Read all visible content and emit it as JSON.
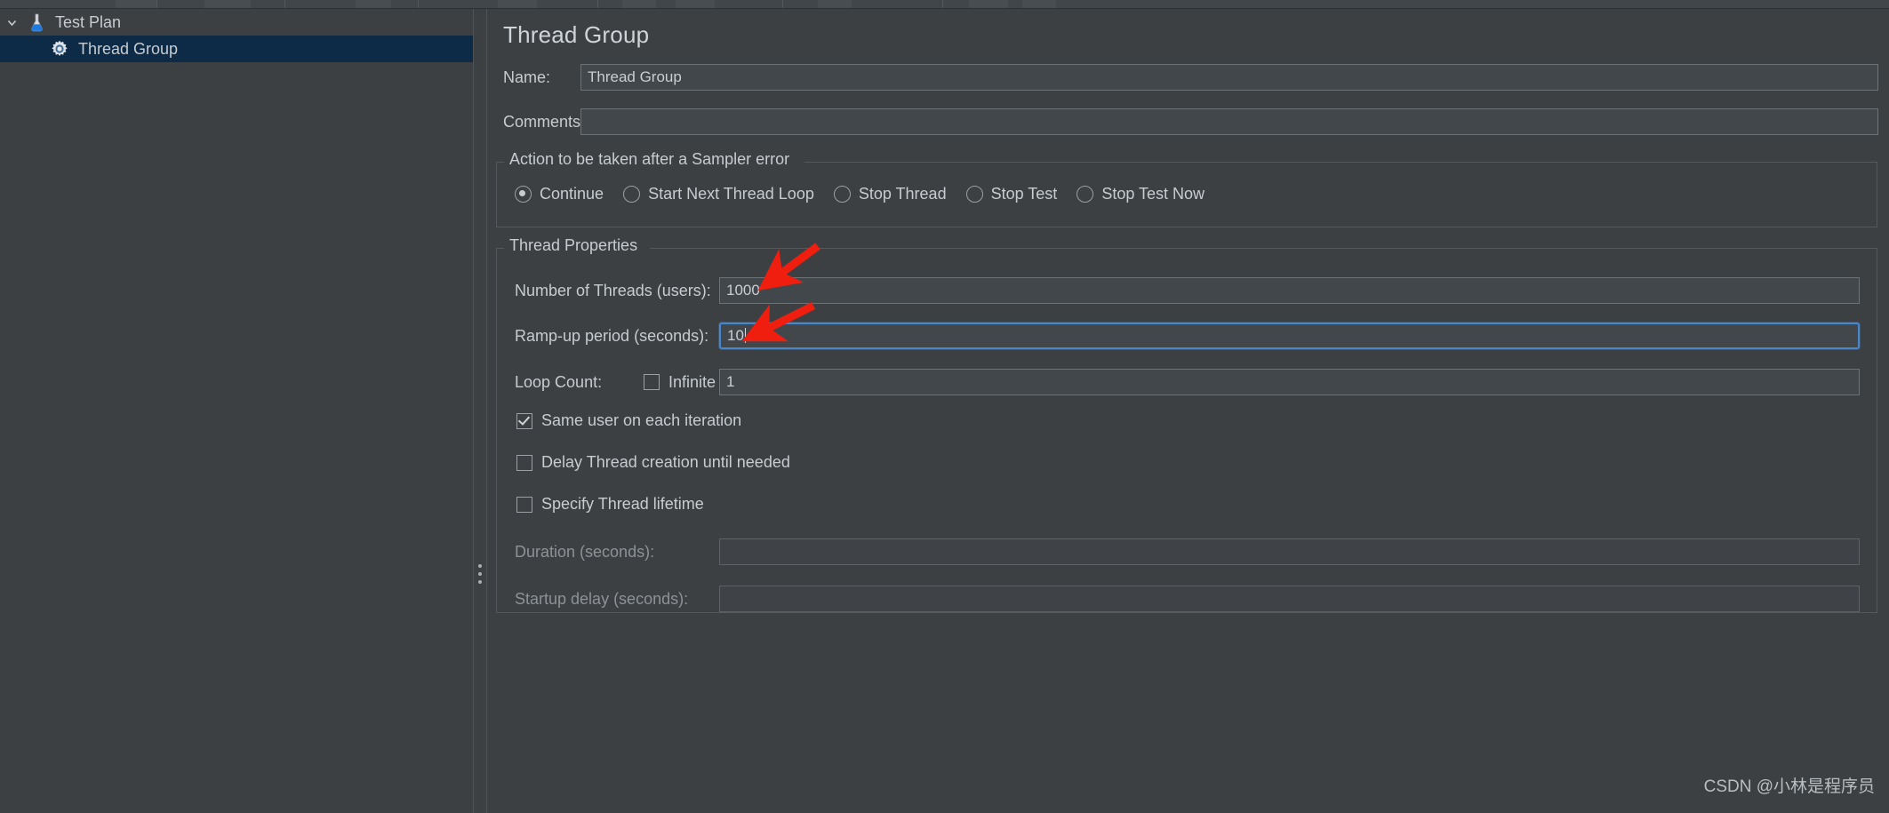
{
  "tree": {
    "items": [
      {
        "label": "Test Plan",
        "icon": "flask-icon",
        "expanded": true,
        "selected": false,
        "depth": 0
      },
      {
        "label": "Thread Group",
        "icon": "gear-icon",
        "expanded": false,
        "selected": true,
        "depth": 1
      }
    ]
  },
  "panel": {
    "title": "Thread Group",
    "name": {
      "label": "Name:",
      "value": "Thread Group"
    },
    "comments": {
      "label": "Comments:",
      "value": ""
    }
  },
  "sampler_error": {
    "title": "Action to be taken after a Sampler error",
    "options": [
      {
        "label": "Continue",
        "selected": true
      },
      {
        "label": "Start Next Thread Loop",
        "selected": false
      },
      {
        "label": "Stop Thread",
        "selected": false
      },
      {
        "label": "Stop Test",
        "selected": false
      },
      {
        "label": "Stop Test Now",
        "selected": false
      }
    ]
  },
  "thread_properties": {
    "title": "Thread Properties",
    "number_of_threads": {
      "label": "Number of Threads (users):",
      "value": "1000"
    },
    "ramp_up": {
      "label": "Ramp-up period (seconds):",
      "value": "10",
      "focused": true
    },
    "loop_count": {
      "label": "Loop Count:",
      "infinite_label": "Infinite",
      "infinite_checked": false,
      "value": "1"
    },
    "checkboxes": [
      {
        "label": "Same user on each iteration",
        "checked": true
      },
      {
        "label": "Delay Thread creation until needed",
        "checked": false
      },
      {
        "label": "Specify Thread lifetime",
        "checked": false
      }
    ],
    "duration": {
      "label": "Duration (seconds):",
      "value": "",
      "disabled": true
    },
    "startup_delay": {
      "label": "Startup delay (seconds):",
      "value": "",
      "disabled": true
    }
  },
  "watermark": {
    "text": "CSDN @小林是程序员"
  },
  "colors": {
    "background": "#3c4043",
    "selection": "#0d2b46",
    "focus_border": "#4a87c8",
    "annotation_arrow": "#f01e0f",
    "text": "#c7ccd1",
    "disabled_text": "#8d9297"
  }
}
